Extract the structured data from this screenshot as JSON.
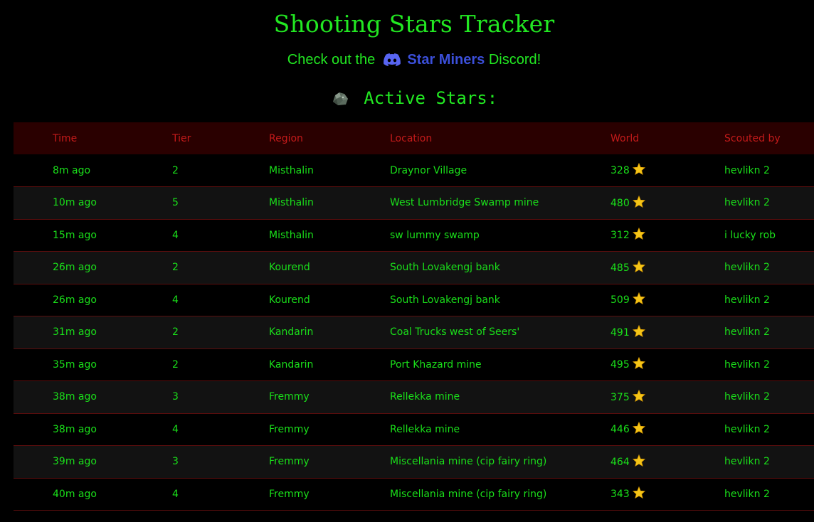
{
  "header": {
    "title": "Shooting Stars Tracker",
    "discord_prefix": "Check out the",
    "discord_link": "Star Miners",
    "discord_suffix": "Discord!"
  },
  "section": {
    "heading": "Active Stars:",
    "icon": "rock-icon"
  },
  "table": {
    "columns": [
      "Time",
      "Tier",
      "Region",
      "Location",
      "World",
      "Scouted by"
    ],
    "rows": [
      {
        "time": "8m ago",
        "tier": "2",
        "region": "Misthalin",
        "location": "Draynor Village",
        "world": "328",
        "scout": "hevlikn 2"
      },
      {
        "time": "10m ago",
        "tier": "5",
        "region": "Misthalin",
        "location": "West Lumbridge Swamp mine",
        "world": "480",
        "scout": "hevlikn 2"
      },
      {
        "time": "15m ago",
        "tier": "4",
        "region": "Misthalin",
        "location": "sw lummy swamp",
        "world": "312",
        "scout": "i lucky rob"
      },
      {
        "time": "26m ago",
        "tier": "2",
        "region": "Kourend",
        "location": "South Lovakengj bank",
        "world": "485",
        "scout": "hevlikn 2"
      },
      {
        "time": "26m ago",
        "tier": "4",
        "region": "Kourend",
        "location": "South Lovakengj bank",
        "world": "509",
        "scout": "hevlikn 2"
      },
      {
        "time": "31m ago",
        "tier": "2",
        "region": "Kandarin",
        "location": "Coal Trucks west of Seers'",
        "world": "491",
        "scout": "hevlikn 2"
      },
      {
        "time": "35m ago",
        "tier": "2",
        "region": "Kandarin",
        "location": "Port Khazard mine",
        "world": "495",
        "scout": "hevlikn 2"
      },
      {
        "time": "38m ago",
        "tier": "3",
        "region": "Fremmy",
        "location": "Rellekka mine",
        "world": "375",
        "scout": "hevlikn 2"
      },
      {
        "time": "38m ago",
        "tier": "4",
        "region": "Fremmy",
        "location": "Rellekka mine",
        "world": "446",
        "scout": "hevlikn 2"
      },
      {
        "time": "39m ago",
        "tier": "3",
        "region": "Fremmy",
        "location": "Miscellania mine (cip fairy ring)",
        "world": "464",
        "scout": "hevlikn 2"
      },
      {
        "time": "40m ago",
        "tier": "4",
        "region": "Fremmy",
        "location": "Miscellania mine (cip fairy ring)",
        "world": "343",
        "scout": "hevlikn 2"
      }
    ]
  },
  "colors": {
    "accent_green": "#22e822",
    "header_red": "#c41a1a",
    "link_blue": "#3b4fd9",
    "star_yellow": "#f5c518"
  }
}
